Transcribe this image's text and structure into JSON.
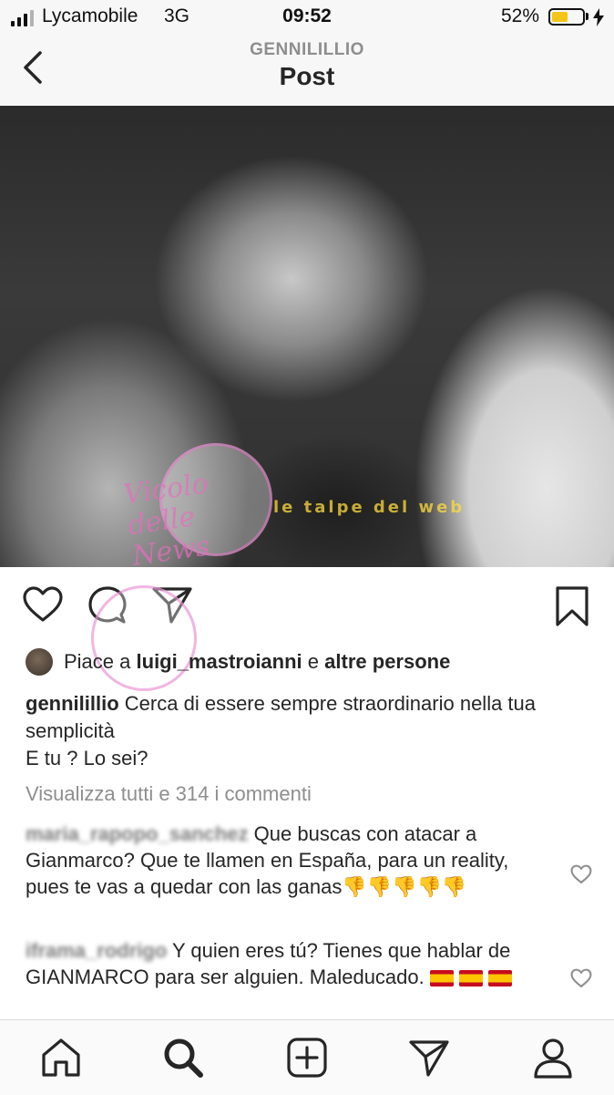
{
  "status_bar": {
    "carrier": "Lycamobile",
    "network": "3G",
    "time": "09:52",
    "battery_percent": "52%",
    "battery_level": 0.52,
    "battery_color": "#f5c518"
  },
  "header": {
    "username": "GENNILILLIO",
    "title": "Post",
    "back_icon": "chevron-left-icon"
  },
  "post": {
    "image_description_icon": "photo",
    "watermark": {
      "script_text": "Vicolo delle News",
      "banner_text": "le talpe del web"
    },
    "actions": {
      "like_icon": "heart-icon",
      "comment_icon": "comment-icon",
      "share_icon": "send-icon",
      "save_icon": "bookmark-icon"
    },
    "likes": {
      "prefix": "Piace a",
      "user": "luigi_mastroianni",
      "middle": "e",
      "suffix": "altre persone"
    },
    "caption": {
      "user": "gennilillio",
      "text_line1": "Cerca di essere sempre straordinario nella tua semplicità",
      "text_line2": "E tu ? Lo sei?"
    },
    "view_all_comments": "Visualizza tutti e 314 i commenti",
    "comments": [
      {
        "user": "maria_rapopo_sanchez",
        "text": "Que buscas con atacar a Gianmarco? Que te llamen en España, para un reality, pues te vas a quedar con las ganas",
        "emoji": "👎👎👎👎👎"
      },
      {
        "user": "iframa_rodrigo",
        "text": "Y quien eres tú? Tienes que hablar de GIANMARCO para ser alguien. Maleducado.",
        "flags": 3
      }
    ]
  },
  "tab_bar": {
    "items": [
      "home-icon",
      "search-icon",
      "add-post-icon",
      "activity-send-icon",
      "profile-icon"
    ]
  }
}
